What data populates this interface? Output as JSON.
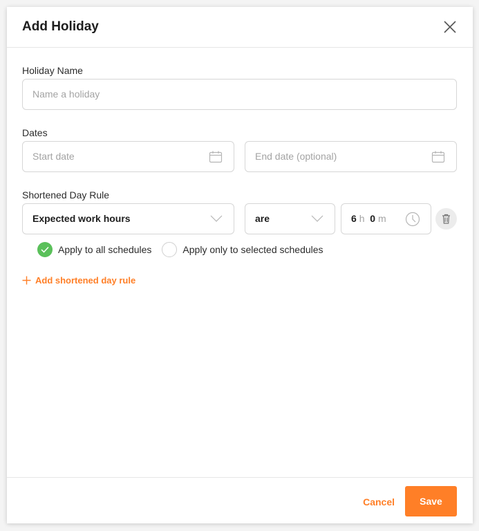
{
  "dialog": {
    "title": "Add Holiday",
    "close_icon": "close-icon"
  },
  "holiday_name": {
    "label": "Holiday Name",
    "placeholder": "Name a holiday",
    "value": ""
  },
  "dates": {
    "label": "Dates",
    "start_placeholder": "Start date",
    "end_placeholder": "End date (optional)",
    "icon": "calendar-icon"
  },
  "shortened_day_rule": {
    "label": "Shortened Day Rule",
    "metric_value": "Expected work hours",
    "operator_value": "are",
    "hours_value": "6",
    "hours_unit": "h",
    "minutes_value": "0",
    "minutes_unit": "m",
    "clock_icon": "clock-icon",
    "delete_icon": "trash-icon"
  },
  "schedule_scope": {
    "options": [
      {
        "label": "Apply to all schedules",
        "selected": true
      },
      {
        "label": "Apply only to selected schedules",
        "selected": false
      }
    ]
  },
  "add_rule": {
    "label": "Add shortened day rule",
    "icon": "plus-icon"
  },
  "footer": {
    "cancel_label": "Cancel",
    "save_label": "Save"
  },
  "colors": {
    "accent": "#ff7f27",
    "success": "#5ac05a"
  }
}
